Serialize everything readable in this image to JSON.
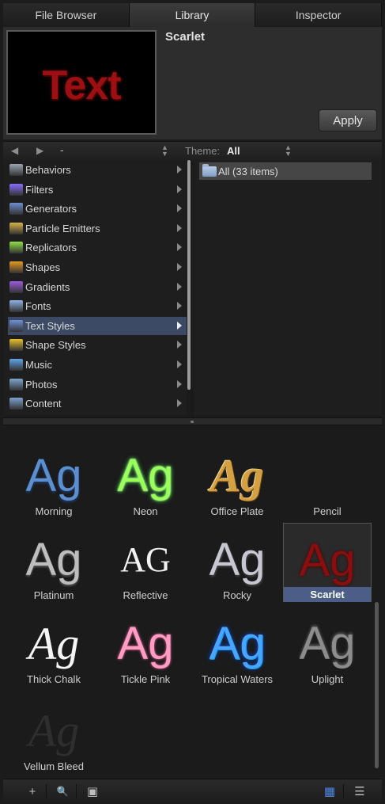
{
  "tabs": [
    "File Browser",
    "Library",
    "Inspector"
  ],
  "preview": {
    "sample_text": "Text",
    "name": "Scarlet",
    "apply_label": "Apply"
  },
  "nav": {
    "back": "◀",
    "forward": "▶",
    "path": "-",
    "theme_label": "Theme:",
    "theme_value": "All"
  },
  "categories": [
    {
      "label": "Behaviors",
      "icon": "gear-icon",
      "color": "#9aa4b2"
    },
    {
      "label": "Filters",
      "icon": "filters-icon",
      "color": "#8a6dff"
    },
    {
      "label": "Generators",
      "icon": "generators-icon",
      "color": "#6d8fd0"
    },
    {
      "label": "Particle Emitters",
      "icon": "particle-emitters-icon",
      "color": "#d7b24a"
    },
    {
      "label": "Replicators",
      "icon": "replicators-icon",
      "color": "#8fe046"
    },
    {
      "label": "Shapes",
      "icon": "shapes-icon",
      "color": "#e49a22"
    },
    {
      "label": "Gradients",
      "icon": "gradients-icon",
      "color": "#9b5be0"
    },
    {
      "label": "Fonts",
      "icon": "fonts-icon",
      "color": "#8fb3e8"
    },
    {
      "label": "Text Styles",
      "icon": "text-styles-icon",
      "color": "#6f8fd6"
    },
    {
      "label": "Shape Styles",
      "icon": "shape-styles-icon",
      "color": "#e8c12a"
    },
    {
      "label": "Music",
      "icon": "music-icon",
      "color": "#5fa4ea"
    },
    {
      "label": "Photos",
      "icon": "photos-icon",
      "color": "#7ea6d0"
    },
    {
      "label": "Content",
      "icon": "content-folder-icon",
      "color": "#7ea2d2"
    }
  ],
  "selected_category": "Text Styles",
  "items": [
    {
      "label": "All (33 items)"
    }
  ],
  "styles": [
    {
      "label": "Morning",
      "sample": "Ag",
      "cls": "s-morning"
    },
    {
      "label": "Neon",
      "sample": "Ag",
      "cls": "s-neon"
    },
    {
      "label": "Office Plate",
      "sample": "Ag",
      "cls": "s-office"
    },
    {
      "label": "Pencil",
      "sample": "",
      "cls": "s-pencil"
    },
    {
      "label": "Platinum",
      "sample": "Ag",
      "cls": "s-platinum"
    },
    {
      "label": "Reflective",
      "sample": "AG",
      "cls": "s-reflective"
    },
    {
      "label": "Rocky",
      "sample": "Ag",
      "cls": "s-rocky"
    },
    {
      "label": "Scarlet",
      "sample": "Ag",
      "cls": "s-scarlet",
      "selected": true
    },
    {
      "label": "Thick Chalk",
      "sample": "Ag",
      "cls": "s-chalk"
    },
    {
      "label": "Tickle Pink",
      "sample": "Ag",
      "cls": "s-tickle"
    },
    {
      "label": "Tropical Waters",
      "sample": "Ag",
      "cls": "s-tropical"
    },
    {
      "label": "Uplight",
      "sample": "Ag",
      "cls": "s-uplight"
    },
    {
      "label": "Vellum Bleed",
      "sample": "Ag",
      "cls": "s-vellum"
    }
  ],
  "toolbar": {
    "add": "+",
    "search": "🔍",
    "preview": "▣",
    "grid_view": "▦",
    "list_view": "☰"
  }
}
